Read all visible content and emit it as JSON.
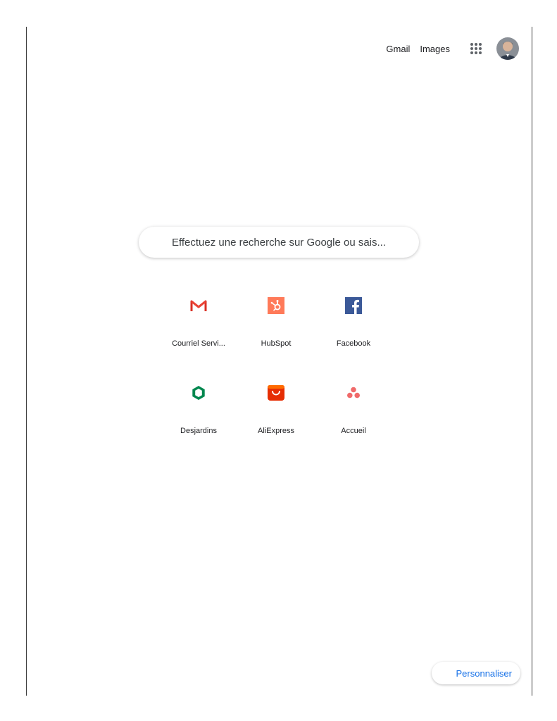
{
  "header": {
    "gmail_label": "Gmail",
    "images_label": "Images",
    "apps_icon": "apps-grid-icon",
    "avatar_icon": "user-avatar"
  },
  "search": {
    "placeholder": "Effectuez une recherche sur Google ou sais..."
  },
  "shortcuts": [
    {
      "label": "Courriel Servi...",
      "icon": "gmail-icon",
      "color": "#d93025"
    },
    {
      "label": "HubSpot",
      "icon": "hubspot-icon",
      "color": "#ff7a59"
    },
    {
      "label": "Facebook",
      "icon": "facebook-icon",
      "color": "#3b5998"
    },
    {
      "label": "Desjardins",
      "icon": "desjardins-icon",
      "color": "#00874e"
    },
    {
      "label": "AliExpress",
      "icon": "aliexpress-icon",
      "color": "#e62e04"
    },
    {
      "label": "Accueil",
      "icon": "asana-icon",
      "color": "#f06a6a"
    }
  ],
  "footer": {
    "customize_label": "Personnaliser"
  },
  "colors": {
    "accent": "#1a73e8",
    "text": "#202124"
  }
}
